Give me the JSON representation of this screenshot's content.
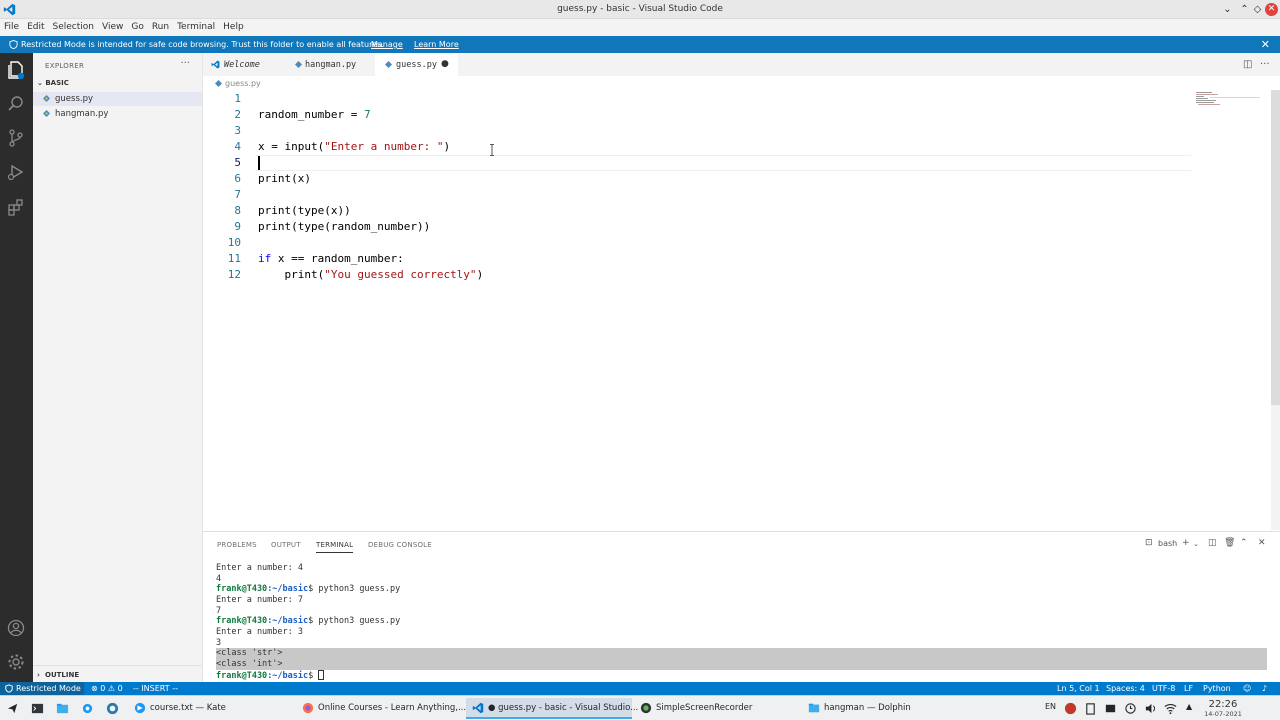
{
  "window": {
    "title": "guess.py - basic - Visual Studio Code"
  },
  "menu": [
    "File",
    "Edit",
    "Selection",
    "View",
    "Go",
    "Run",
    "Terminal",
    "Help"
  ],
  "banner": {
    "message": "Restricted Mode is intended for safe code browsing. Trust this folder to enable all features.",
    "manage": "Manage",
    "learn_more": "Learn More"
  },
  "explorer": {
    "header": "EXPLORER",
    "folder": "BASIC",
    "files": [
      "guess.py",
      "hangman.py"
    ],
    "outline": "OUTLINE"
  },
  "tabs": [
    {
      "label": "Welcome"
    },
    {
      "label": "hangman.py"
    },
    {
      "label": "guess.py",
      "dirty_mark": "●"
    }
  ],
  "breadcrumb": "guess.py",
  "editor": {
    "line_numbers": [
      "1",
      "2",
      "3",
      "4",
      "5",
      "6",
      "7",
      "8",
      "9",
      "10",
      "11",
      "12"
    ],
    "lines": [
      "",
      "random_number = 7",
      "",
      "x = input(\"Enter a number: \")",
      "",
      "print(x)",
      "",
      "print(type(x))",
      "print(type(random_number))",
      "",
      "if x == random_number:",
      "    print(\"You guessed correctly\")"
    ],
    "current_line": 5
  },
  "panel": {
    "tabs": [
      "PROBLEMS",
      "OUTPUT",
      "TERMINAL",
      "DEBUG CONSOLE"
    ],
    "active_tab": "TERMINAL",
    "shell": "bash",
    "prompt_user": "frank@T430",
    "prompt_path": ":~/basic",
    "terminal": {
      "l1": "Enter a number: 4",
      "l2": "4",
      "l3_cmd": "$ python3 guess.py",
      "l4": "Enter a number: 7",
      "l5": "7",
      "l6_cmd": "$ python3 guess.py",
      "l7": "Enter a number: 3",
      "l8": "3",
      "l9": "<class 'str'>",
      "l10": "<class 'int'>",
      "l11_cmd": "$ "
    }
  },
  "status": {
    "restricted": "Restricted Mode",
    "problems": "⊗ 0 ⚠ 0",
    "mode": "-- INSERT --",
    "position": "Ln 5, Col 1",
    "spaces": "Spaces: 4",
    "encoding": "UTF-8",
    "eol": "LF",
    "language": "Python"
  },
  "taskbar": {
    "tasks": [
      "course.txt — Kate",
      "Online Courses - Learn Anything,...",
      "● guess.py - basic - Visual Studio...",
      "SimpleScreenRecorder",
      "hangman — Dolphin"
    ],
    "lang": "EN",
    "time": "22:26",
    "date": "14-07-2021"
  },
  "colors": {
    "accent": "#007acc",
    "banner": "#1177bb",
    "keyword": "#0000ff",
    "string": "#a31515",
    "number": "#098658"
  }
}
